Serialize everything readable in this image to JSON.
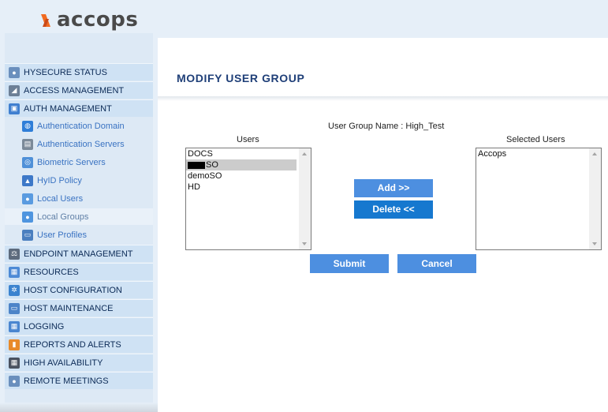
{
  "brand": {
    "name": "accops",
    "accent": "#f26b21"
  },
  "sidebar": {
    "items": [
      {
        "label": "HYSECURE STATUS",
        "icon": "status-eye-icon",
        "level": "main"
      },
      {
        "label": "ACCESS MANAGEMENT",
        "icon": "access-key-icon",
        "level": "main"
      },
      {
        "label": "AUTH MANAGEMENT",
        "icon": "lock-icon",
        "level": "main"
      },
      {
        "label": "Authentication Domain",
        "icon": "globe-icon",
        "level": "sub"
      },
      {
        "label": "Authentication Servers",
        "icon": "servers-icon",
        "level": "sub"
      },
      {
        "label": "Biometric Servers",
        "icon": "fingerprint-icon",
        "level": "sub"
      },
      {
        "label": "HyID Policy",
        "icon": "policy-icon",
        "level": "sub"
      },
      {
        "label": "Local Users",
        "icon": "user-icon",
        "level": "sub"
      },
      {
        "label": "Local Groups",
        "icon": "group-icon",
        "level": "sub",
        "active": true
      },
      {
        "label": "User Profiles",
        "icon": "profile-monitor-icon",
        "level": "sub"
      },
      {
        "label": "ENDPOINT MANAGEMENT",
        "icon": "balance-scale-icon",
        "level": "main"
      },
      {
        "label": "RESOURCES",
        "icon": "resources-icon",
        "level": "main"
      },
      {
        "label": "HOST CONFIGURATION",
        "icon": "gear-icon",
        "level": "main"
      },
      {
        "label": "HOST MAINTENANCE",
        "icon": "maintenance-icon",
        "level": "main"
      },
      {
        "label": "LOGGING",
        "icon": "calendar-icon",
        "level": "main"
      },
      {
        "label": "REPORTS AND ALERTS",
        "icon": "bar-chart-icon",
        "level": "main"
      },
      {
        "label": "HIGH AVAILABILITY",
        "icon": "grid-icon",
        "level": "main"
      },
      {
        "label": "REMOTE MEETINGS",
        "icon": "meeting-people-icon",
        "level": "main"
      }
    ]
  },
  "main": {
    "title": "MODIFY USER GROUP",
    "group_name_label": "User Group Name : High_Test",
    "users_label": "Users",
    "selected_label": "Selected Users",
    "users": [
      {
        "text": "DOCS",
        "selected": false,
        "redacted": false
      },
      {
        "text": "SO",
        "selected": true,
        "redacted": true
      },
      {
        "text": "demoSO",
        "selected": false,
        "redacted": false
      },
      {
        "text": "HD",
        "selected": false,
        "redacted": false
      }
    ],
    "selected_users": [
      "Accops"
    ],
    "add_label": "Add >>",
    "delete_label": "Delete <<",
    "submit_label": "Submit",
    "cancel_label": "Cancel"
  }
}
